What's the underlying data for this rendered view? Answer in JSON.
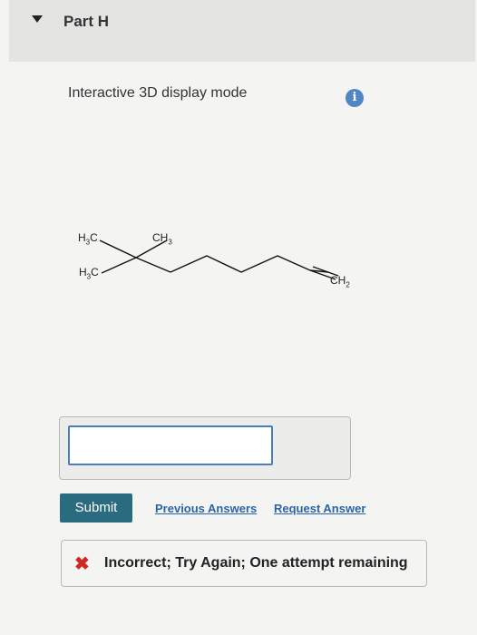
{
  "part": {
    "title": "Part H"
  },
  "display": {
    "mode_label": "Interactive 3D display mode",
    "info_icon": "i"
  },
  "molecule": {
    "labels": {
      "h3c_top": "H3C",
      "ch3_top": "CH3",
      "h3c_bottom": "H3C",
      "ch2": "CH2"
    }
  },
  "answer": {
    "input_value": ""
  },
  "actions": {
    "submit": "Submit",
    "previous_answers": "Previous Answers",
    "request_answer": "Request Answer"
  },
  "feedback": {
    "icon": "✖",
    "message": "Incorrect; Try Again; One attempt remaining"
  },
  "colors": {
    "submit_bg": "#2a6b80",
    "link": "#2a64a8",
    "error": "#d22727",
    "info": "#4f86c4"
  }
}
